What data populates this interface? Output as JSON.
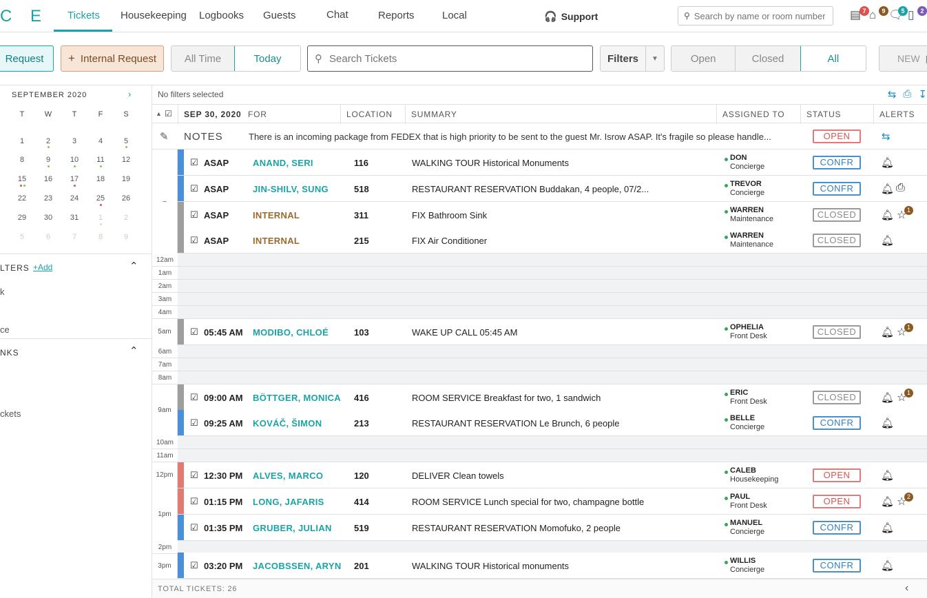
{
  "logo": "C E",
  "nav": {
    "tabs": [
      "Tickets",
      "Housekeeping",
      "Logbooks",
      "Guests",
      "Chat",
      "Reports",
      "Local"
    ],
    "support": "Support",
    "search_placeholder": "Search by name or room number",
    "badges": [
      "7",
      "9",
      "5",
      "2"
    ]
  },
  "toolbar": {
    "request": "Request",
    "internal": "Internal Request",
    "time_options": [
      "All Time",
      "Today"
    ],
    "search_placeholder": "Search Tickets",
    "filters": "Filters",
    "status_options": [
      "Open",
      "Closed",
      "All"
    ],
    "new": "NEW"
  },
  "calendar": {
    "title": "SEPTEMBER 2020",
    "headers": [
      "T",
      "W",
      "T",
      "F",
      "S"
    ],
    "weeks": [
      [
        "1",
        "2",
        "3",
        "4",
        "5"
      ],
      [
        "8",
        "9",
        "10",
        "11",
        "12"
      ],
      [
        "15",
        "16",
        "17",
        "18",
        "19"
      ],
      [
        "22",
        "23",
        "24",
        "25",
        "26"
      ],
      [
        "29",
        "30",
        "31",
        "1",
        "2"
      ],
      [
        "5",
        "6",
        "7",
        "8",
        "9"
      ]
    ]
  },
  "left": {
    "filters_title": "LTERS",
    "add": "+Add",
    "filter_items": [
      "k",
      "ce"
    ],
    "links_title": "NKS",
    "link_items": [
      "ckets"
    ]
  },
  "main": {
    "no_filters": "No filters selected",
    "columns": {
      "date": "SEP 30, 2020",
      "for": "FOR",
      "location": "LOCATION",
      "summary": "SUMMARY",
      "assigned": "ASSIGNED TO",
      "status": "STATUS",
      "alerts": "ALERTS"
    },
    "notes_label": "NOTES",
    "notes_text": "There is an incoming package from FEDEX that is high priority to be sent to the guest Mr. Isrow ASAP.  It's fragile so please handle...",
    "notes_status": "OPEN",
    "asap_gutter": "–",
    "hours": {
      "h12am": "12am",
      "h1am": "1am",
      "h2am": "2am",
      "h3am": "3am",
      "h4am": "4am",
      "h5am": "5am",
      "h6am": "6am",
      "h7am": "7am",
      "h8am": "8am",
      "h9am": "9am",
      "h10am": "10am",
      "h11am": "11am",
      "h12pm": "12pm",
      "h1pm": "1pm",
      "h2pm": "2pm",
      "h3pm": "3pm"
    },
    "tickets": [
      {
        "time": "ASAP",
        "for": "ANAND, SERI",
        "loc": "116",
        "summary": "WALKING TOUR Historical Monuments",
        "name": "DON",
        "dept": "Concierge",
        "status": "CONFR"
      },
      {
        "time": "ASAP",
        "for": "JIN-SHILV, SUNG",
        "loc": "518",
        "summary": "RESTAURANT RESERVATION Buddakan, 4 people, 07/2...",
        "name": "TREVOR",
        "dept": "Concierge",
        "status": "CONFR"
      },
      {
        "time": "ASAP",
        "for": "INTERNAL",
        "loc": "311",
        "summary": "FIX Bathroom Sink",
        "name": "WARREN",
        "dept": "Maintenance",
        "status": "CLOSED",
        "alert_count": "1"
      },
      {
        "time": "ASAP",
        "for": "INTERNAL",
        "loc": "215",
        "summary": "FIX Air Conditioner",
        "name": "WARREN",
        "dept": "Maintenance",
        "status": "CLOSED"
      },
      {
        "time": "05:45 AM",
        "for": "MODIBO, CHLOÉ",
        "loc": "103",
        "summary": "WAKE UP CALL 05:45 AM",
        "name": "OPHELIA",
        "dept": "Front Desk",
        "status": "CLOSED",
        "alert_count": "1"
      },
      {
        "time": "09:00 AM",
        "for": "BÖTTGER, MONICA",
        "loc": "416",
        "summary": "ROOM SERVICE  Breakfast for two, 1 sandwich",
        "name": "ERIC",
        "dept": "Front Desk",
        "status": "CLOSED",
        "alert_count": "1"
      },
      {
        "time": "09:25 AM",
        "for": "KOVÁČ, ŠIMON",
        "loc": "213",
        "summary": "RESTAURANT RESERVATION Le Brunch, 6 people",
        "name": "BELLE",
        "dept": "Concierge",
        "status": "CONFR"
      },
      {
        "time": "12:30 PM",
        "for": "ALVES, MARCO",
        "loc": "120",
        "summary": "DELIVER Clean towels",
        "name": "CALEB",
        "dept": "Housekeeping",
        "status": "OPEN"
      },
      {
        "time": "01:15 PM",
        "for": "LONG, JAFARIS",
        "loc": "414",
        "summary": "ROOM SERVICE  Lunch special for two, champagne bottle",
        "name": "PAUL",
        "dept": "Front Desk",
        "status": "OPEN",
        "alert_count": "2"
      },
      {
        "time": "01:35 PM",
        "for": "GRUBER, JULIAN",
        "loc": "519",
        "summary": "RESTAURANT RESERVATION Momofuko, 2 people",
        "name": "MANUEL",
        "dept": "Concierge",
        "status": "CONFR"
      },
      {
        "time": "03:20 PM",
        "for": "JACOBSSEN, ARYN",
        "loc": "201",
        "summary": "WALKING TOUR Historical monuments",
        "name": "WILLIS",
        "dept": "Concierge",
        "status": "CONFR"
      }
    ],
    "total": "TOTAL TICKETS: 26"
  },
  "colors": {
    "accent": "#1aa3a7",
    "bar_blue": "#4a90d9",
    "bar_gray": "#9e9e9e",
    "bar_red": "#e07a72",
    "guest_teal": "#1aa3a7",
    "internal_brown": "#9a6a2c"
  }
}
